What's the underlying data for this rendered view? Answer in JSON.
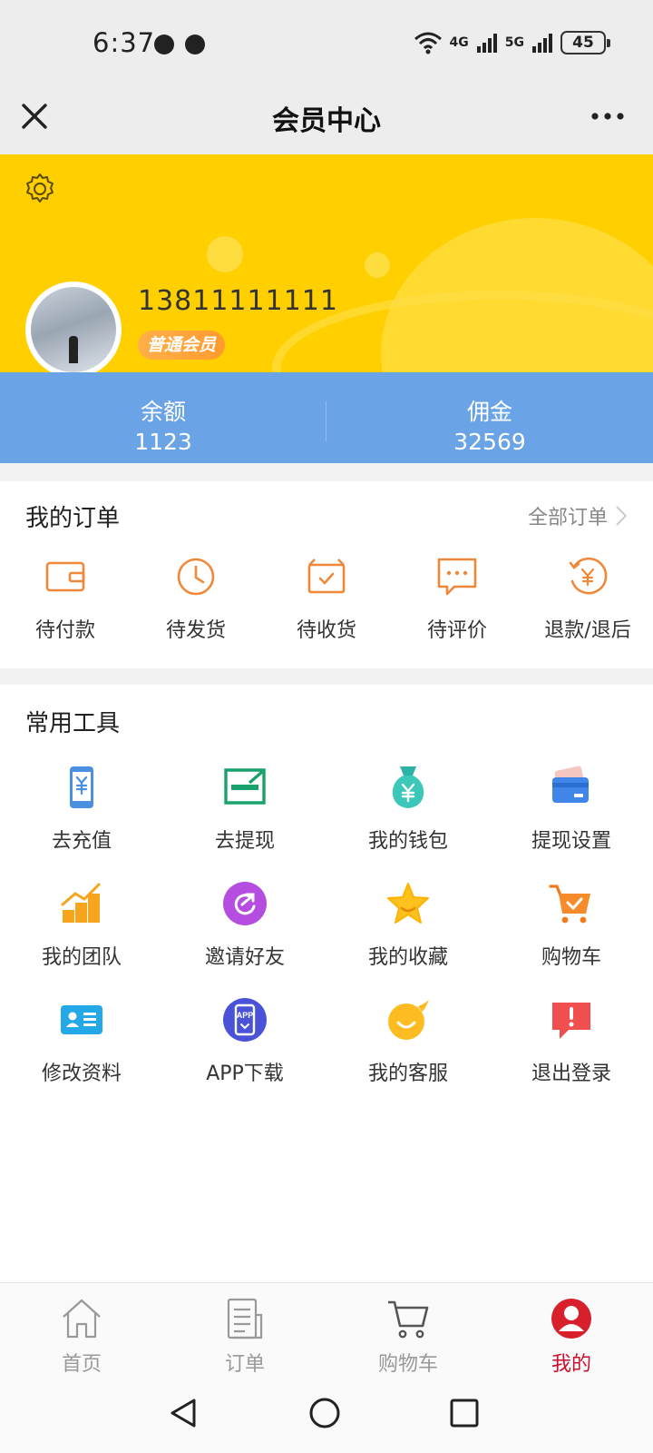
{
  "status": {
    "time": "6:37",
    "net1": "4G",
    "net2": "5G",
    "battery": "45"
  },
  "nav": {
    "title": "会员中心"
  },
  "profile": {
    "phone": "13811111111",
    "level": "普通会员"
  },
  "wallet": {
    "balance_label": "余额",
    "balance_value": "1123",
    "commission_label": "佣金",
    "commission_value": "32569"
  },
  "orders": {
    "title": "我的订单",
    "all_label": "全部订单",
    "items": [
      {
        "label": "待付款",
        "icon": "wallet-icon"
      },
      {
        "label": "待发货",
        "icon": "clock-icon"
      },
      {
        "label": "待收货",
        "icon": "box-check-icon"
      },
      {
        "label": "待评价",
        "icon": "comment-icon"
      },
      {
        "label": "退款/退后",
        "icon": "refund-icon"
      }
    ]
  },
  "tools": {
    "title": "常用工具",
    "items": [
      {
        "label": "去充值",
        "icon": "recharge-phone-icon"
      },
      {
        "label": "去提现",
        "icon": "withdraw-icon"
      },
      {
        "label": "我的钱包",
        "icon": "money-bag-icon"
      },
      {
        "label": "提现设置",
        "icon": "card-settings-icon"
      },
      {
        "label": "我的团队",
        "icon": "team-chart-icon"
      },
      {
        "label": "邀请好友",
        "icon": "share-icon"
      },
      {
        "label": "我的收藏",
        "icon": "star-icon"
      },
      {
        "label": "购物车",
        "icon": "cart-icon"
      },
      {
        "label": "修改资料",
        "icon": "id-card-icon"
      },
      {
        "label": "APP下载",
        "icon": "app-download-icon"
      },
      {
        "label": "我的客服",
        "icon": "customer-service-icon"
      },
      {
        "label": "退出登录",
        "icon": "logout-icon"
      }
    ],
    "app_icon_text": "APP"
  },
  "tabbar": {
    "items": [
      {
        "label": "首页",
        "icon": "home-icon",
        "active": false
      },
      {
        "label": "订单",
        "icon": "order-list-icon",
        "active": false
      },
      {
        "label": "购物车",
        "icon": "cart-icon",
        "active": false
      },
      {
        "label": "我的",
        "icon": "user-icon",
        "active": true
      }
    ]
  },
  "colors": {
    "hero": "#ffcf00",
    "wallet_strip": "#6aa4e6",
    "accent_orange": "#f0883a",
    "active_tab": "#c8102e"
  }
}
